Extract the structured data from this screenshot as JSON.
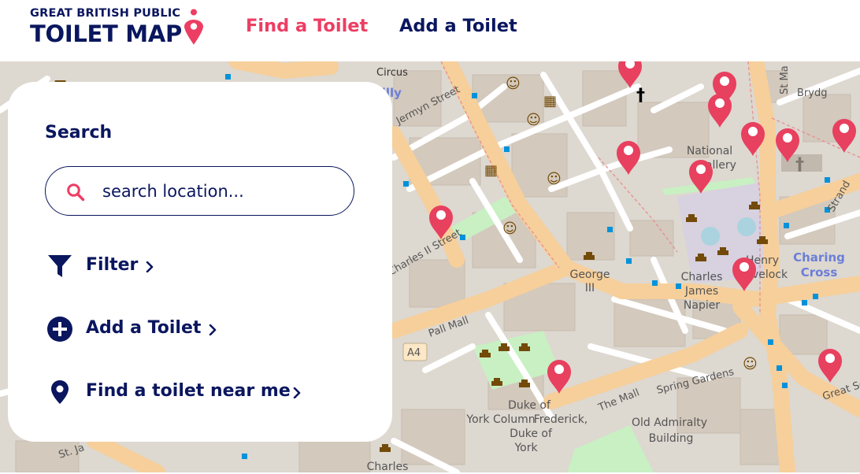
{
  "header": {
    "logo_top": "GREAT BRITISH PUBLIC",
    "logo_main": "TOILET MAP",
    "nav": [
      {
        "label": "Find a Toilet",
        "active": true
      },
      {
        "label": "Add a Toilet",
        "active": false
      }
    ]
  },
  "panel": {
    "title": "Search",
    "search_placeholder": "search location...",
    "actions": [
      {
        "label": "Filter",
        "icon": "filter-icon"
      },
      {
        "label": "Add a Toilet",
        "icon": "plus-circle-icon"
      },
      {
        "label": "Find a toilet near me",
        "icon": "location-pin-icon"
      }
    ]
  },
  "map": {
    "streets": [
      "Jermyn Street",
      "Charles II Street",
      "Pall Mall",
      "A4",
      "The Mall",
      "Spring Gardens",
      "Great Sc",
      "St. Ja",
      "Strand",
      "Brydg",
      "St Ma"
    ],
    "places": [
      "National Gallery",
      "Charing Cross",
      "Old Admiralty Building",
      "George III",
      "Charles James Napier",
      "Henry Havelock",
      "Duke of York Column",
      "Frederick, Duke of York",
      "Charles",
      "Circus",
      "dilly"
    ],
    "colors": {
      "marker": "#e8405f",
      "brand": "#0a165e",
      "accent": "#ed3d63",
      "road_major": "#f6cf9b",
      "land": "#ddd8d0",
      "park": "#c8f0c3"
    }
  }
}
